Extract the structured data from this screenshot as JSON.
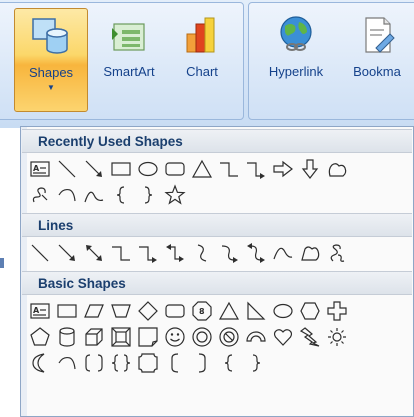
{
  "ribbon": {
    "groups": [
      {
        "buttons": [
          {
            "id": "shapes",
            "label": "Shapes",
            "active": true,
            "has_dropdown": true,
            "icon": "shapes-icon"
          },
          {
            "id": "smartart",
            "label": "SmartArt",
            "active": false,
            "icon": "smartart-icon"
          },
          {
            "id": "chart",
            "label": "Chart",
            "active": false,
            "icon": "chart-icon"
          }
        ]
      },
      {
        "buttons": [
          {
            "id": "hyperlink",
            "label": "Hyperlink",
            "active": false,
            "icon": "globe-link-icon"
          },
          {
            "id": "bookmark",
            "label": "Bookma",
            "active": false,
            "icon": "bookmark-icon"
          }
        ]
      }
    ]
  },
  "dropdown": {
    "sections": [
      {
        "title": "Recently Used Shapes",
        "rows": [
          [
            "text-box",
            "line",
            "arrow-line",
            "rectangle",
            "oval",
            "rounded-rectangle",
            "triangle",
            "elbow-connector",
            "elbow-arrow-connector",
            "right-arrow",
            "down-arrow",
            "flowchart-manual-operation"
          ],
          [
            "freeform-squiggle",
            "arc",
            "freeform-curve",
            "left-brace",
            "right-brace",
            "star"
          ]
        ]
      },
      {
        "title": "Lines",
        "rows": [
          [
            "line",
            "arrow-line",
            "double-arrow-line",
            "elbow-connector",
            "elbow-arrow-connector",
            "elbow-double-arrow-connector",
            "curved-connector",
            "curved-arrow-connector",
            "curved-double-arrow-connector",
            "curve",
            "freeform",
            "scribble"
          ]
        ]
      },
      {
        "title": "Basic Shapes",
        "rows": [
          [
            "text-box",
            "rectangle",
            "parallelogram",
            "trapezoid",
            "diamond",
            "rounded-rectangle",
            "octagon-label",
            "triangle",
            "right-triangle",
            "oval",
            "hexagon",
            "cross"
          ],
          [
            "pentagon",
            "can",
            "cube",
            "bevel",
            "folded-corner",
            "smiley-face",
            "donut",
            "no-symbol",
            "block-arc",
            "heart",
            "lightning-bolt",
            "sun"
          ],
          [
            "moon",
            "arc",
            "double-bracket",
            "double-brace",
            "plaque",
            "left-bracket",
            "right-bracket",
            "left-brace",
            "right-brace"
          ]
        ]
      }
    ]
  }
}
